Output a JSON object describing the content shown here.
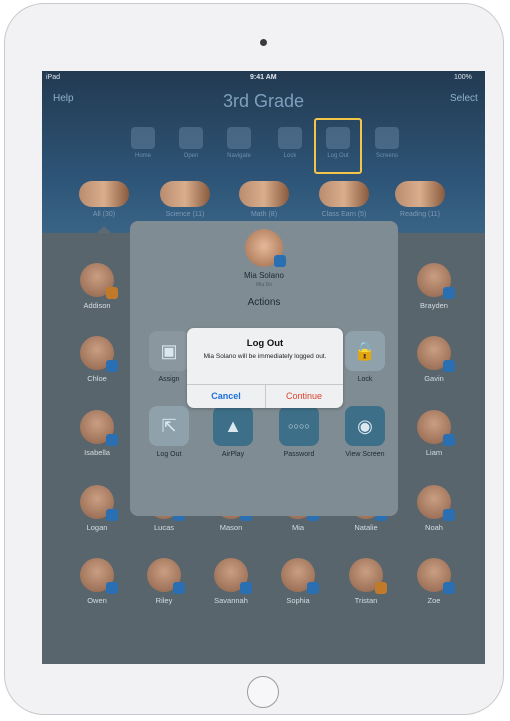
{
  "status": {
    "carrier": "iPad",
    "time": "9:41 AM",
    "battery": "100%"
  },
  "header": {
    "title": "3rd Grade",
    "left_link": "Help",
    "right_link": "Select",
    "toolbar": [
      {
        "label": "Home",
        "icon": "home-icon"
      },
      {
        "label": "Open",
        "icon": "open-app-icon"
      },
      {
        "label": "Navigate",
        "icon": "navigate-icon"
      },
      {
        "label": "Lock",
        "icon": "lock-icon"
      },
      {
        "label": "Log Out",
        "icon": "log-out-icon",
        "highlighted": true
      },
      {
        "label": "Screens",
        "icon": "screens-icon"
      }
    ],
    "groups": [
      {
        "label": "All (30)"
      },
      {
        "label": "Science (11)"
      },
      {
        "label": "Math (8)"
      },
      {
        "label": "Class Earn (5)"
      },
      {
        "label": "Reading (11)"
      }
    ]
  },
  "students": [
    {
      "name": "Addison",
      "sub": "",
      "badge": "orange"
    },
    {
      "name": "Brayden",
      "sub": "",
      "badge": "blue"
    },
    {
      "name": "Chloe",
      "sub": "",
      "badge": "blue"
    },
    {
      "name": "Gavin",
      "sub": "",
      "badge": "blue"
    },
    {
      "name": "Isabella",
      "sub": "",
      "badge": "blue"
    },
    {
      "name": "Liam",
      "sub": "",
      "badge": "blue"
    },
    {
      "name": "Logan",
      "sub": "",
      "badge": "blue"
    },
    {
      "name": "Lucas",
      "sub": "",
      "badge": "blue"
    },
    {
      "name": "Mason",
      "sub": "",
      "badge": "blue"
    },
    {
      "name": "Mia",
      "sub": "",
      "badge": "blue"
    },
    {
      "name": "Natalie",
      "sub": "",
      "badge": "blue"
    },
    {
      "name": "Noah",
      "sub": "",
      "badge": "blue"
    },
    {
      "name": "Owen",
      "sub": "",
      "badge": "blue"
    },
    {
      "name": "Riley",
      "sub": "",
      "badge": "blue"
    },
    {
      "name": "Savannah",
      "sub": "",
      "badge": "blue"
    },
    {
      "name": "Sophia",
      "sub": "",
      "badge": "blue"
    },
    {
      "name": "Tristan",
      "sub": "",
      "badge": "orange"
    },
    {
      "name": "Zoe",
      "sub": "",
      "badge": "blue"
    }
  ],
  "sheet": {
    "student_name": "Mia Solano",
    "student_sub": "Mia Do",
    "heading": "Actions",
    "actions": [
      {
        "label": "Assign",
        "icon": "assign-icon"
      },
      {
        "label": "Lock",
        "icon": "lock-icon"
      },
      {
        "label": "Log Out",
        "icon": "log-out-icon"
      },
      {
        "label": "AirPlay",
        "icon": "airplay-icon"
      },
      {
        "label": "Password",
        "icon": "password-icon"
      },
      {
        "label": "View Screen",
        "icon": "view-screen-icon"
      }
    ]
  },
  "alert": {
    "title": "Log Out",
    "message": "Mia Solano will be immediately logged out.",
    "cancel": "Cancel",
    "confirm": "Continue"
  },
  "colors": {
    "accent": "#f3c64a",
    "cancel": "#1a6fe0",
    "destructive": "#e0402e",
    "header": "#2e5679"
  }
}
